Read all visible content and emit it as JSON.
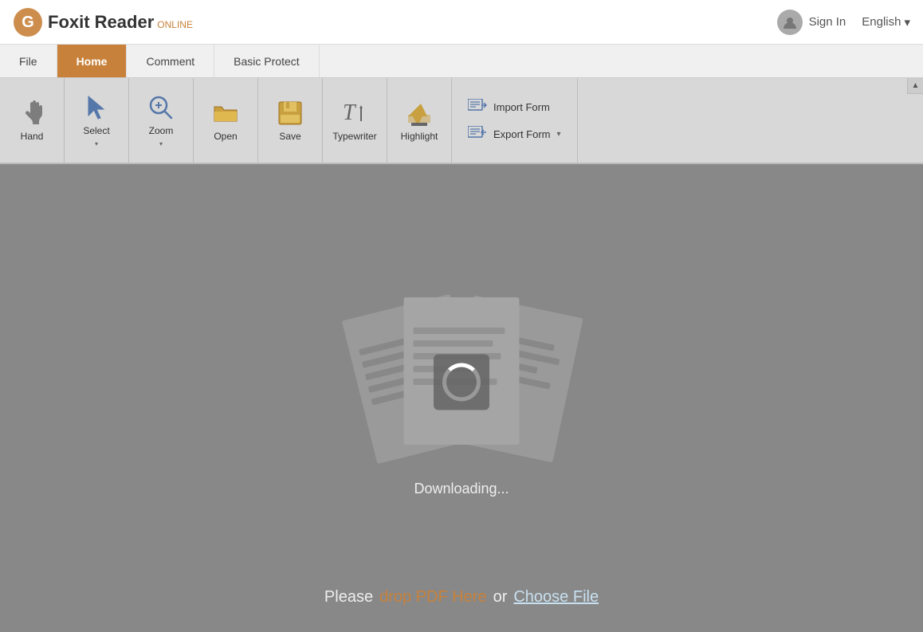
{
  "app": {
    "title": "Foxit Reader",
    "title_suffix": "ONLINE",
    "sign_in": "Sign In",
    "language": "English"
  },
  "nav": {
    "tabs": [
      {
        "id": "file",
        "label": "File",
        "active": false
      },
      {
        "id": "home",
        "label": "Home",
        "active": true
      },
      {
        "id": "comment",
        "label": "Comment",
        "active": false
      },
      {
        "id": "basic-protect",
        "label": "Basic Protect",
        "active": false
      }
    ]
  },
  "toolbar": {
    "items": [
      {
        "id": "hand",
        "label": "Hand",
        "has_dropdown": false
      },
      {
        "id": "select",
        "label": "Select",
        "has_dropdown": true
      },
      {
        "id": "zoom",
        "label": "Zoom",
        "has_dropdown": true
      },
      {
        "id": "open",
        "label": "Open",
        "has_dropdown": false
      },
      {
        "id": "save",
        "label": "Save",
        "has_dropdown": false
      },
      {
        "id": "typewriter",
        "label": "Typewriter",
        "has_dropdown": false
      },
      {
        "id": "highlight",
        "label": "Highlight",
        "has_dropdown": false
      }
    ],
    "form_buttons": [
      {
        "id": "import-form",
        "label": "Import Form"
      },
      {
        "id": "export-form",
        "label": "Export Form"
      }
    ]
  },
  "main": {
    "downloading_text": "Downloading...",
    "please_text": "Please",
    "drop_pdf_text": "drop PDF Here",
    "or_text": "or",
    "choose_file_text": "Choose File"
  }
}
